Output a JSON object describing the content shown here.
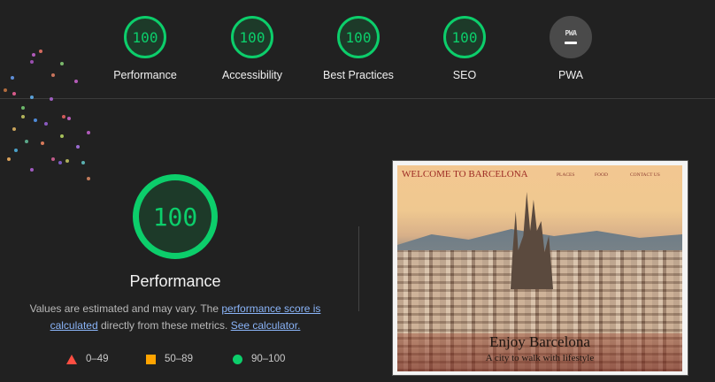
{
  "categories": [
    {
      "label": "Performance",
      "score": "100"
    },
    {
      "label": "Accessibility",
      "score": "100"
    },
    {
      "label": "Best Practices",
      "score": "100"
    },
    {
      "label": "SEO",
      "score": "100"
    },
    {
      "label": "PWA",
      "badge": "PWA"
    }
  ],
  "main": {
    "score": "100",
    "title": "Performance",
    "desc_prefix": "Values are estimated and may vary. The ",
    "link1": "performance score is calculated",
    "desc_mid": " directly from these metrics. ",
    "link2": "See calculator."
  },
  "legend": [
    {
      "label": "0–49",
      "color": "#ff4e42"
    },
    {
      "label": "50–89",
      "color": "#ffa400"
    },
    {
      "label": "90–100",
      "color": "#0cce6b"
    }
  ],
  "screenshot": {
    "site_title": "WELCOME TO BARCELONA",
    "nav": [
      "PLACES",
      "FOOD",
      "CONTACT US"
    ],
    "hero_title": "Enjoy Barcelona",
    "hero_subtitle": "A city to walk with lifestyle"
  },
  "colors": {
    "pass": "#0cce6b",
    "average": "#ffa400",
    "fail": "#ff4e42",
    "background": "#212121"
  }
}
